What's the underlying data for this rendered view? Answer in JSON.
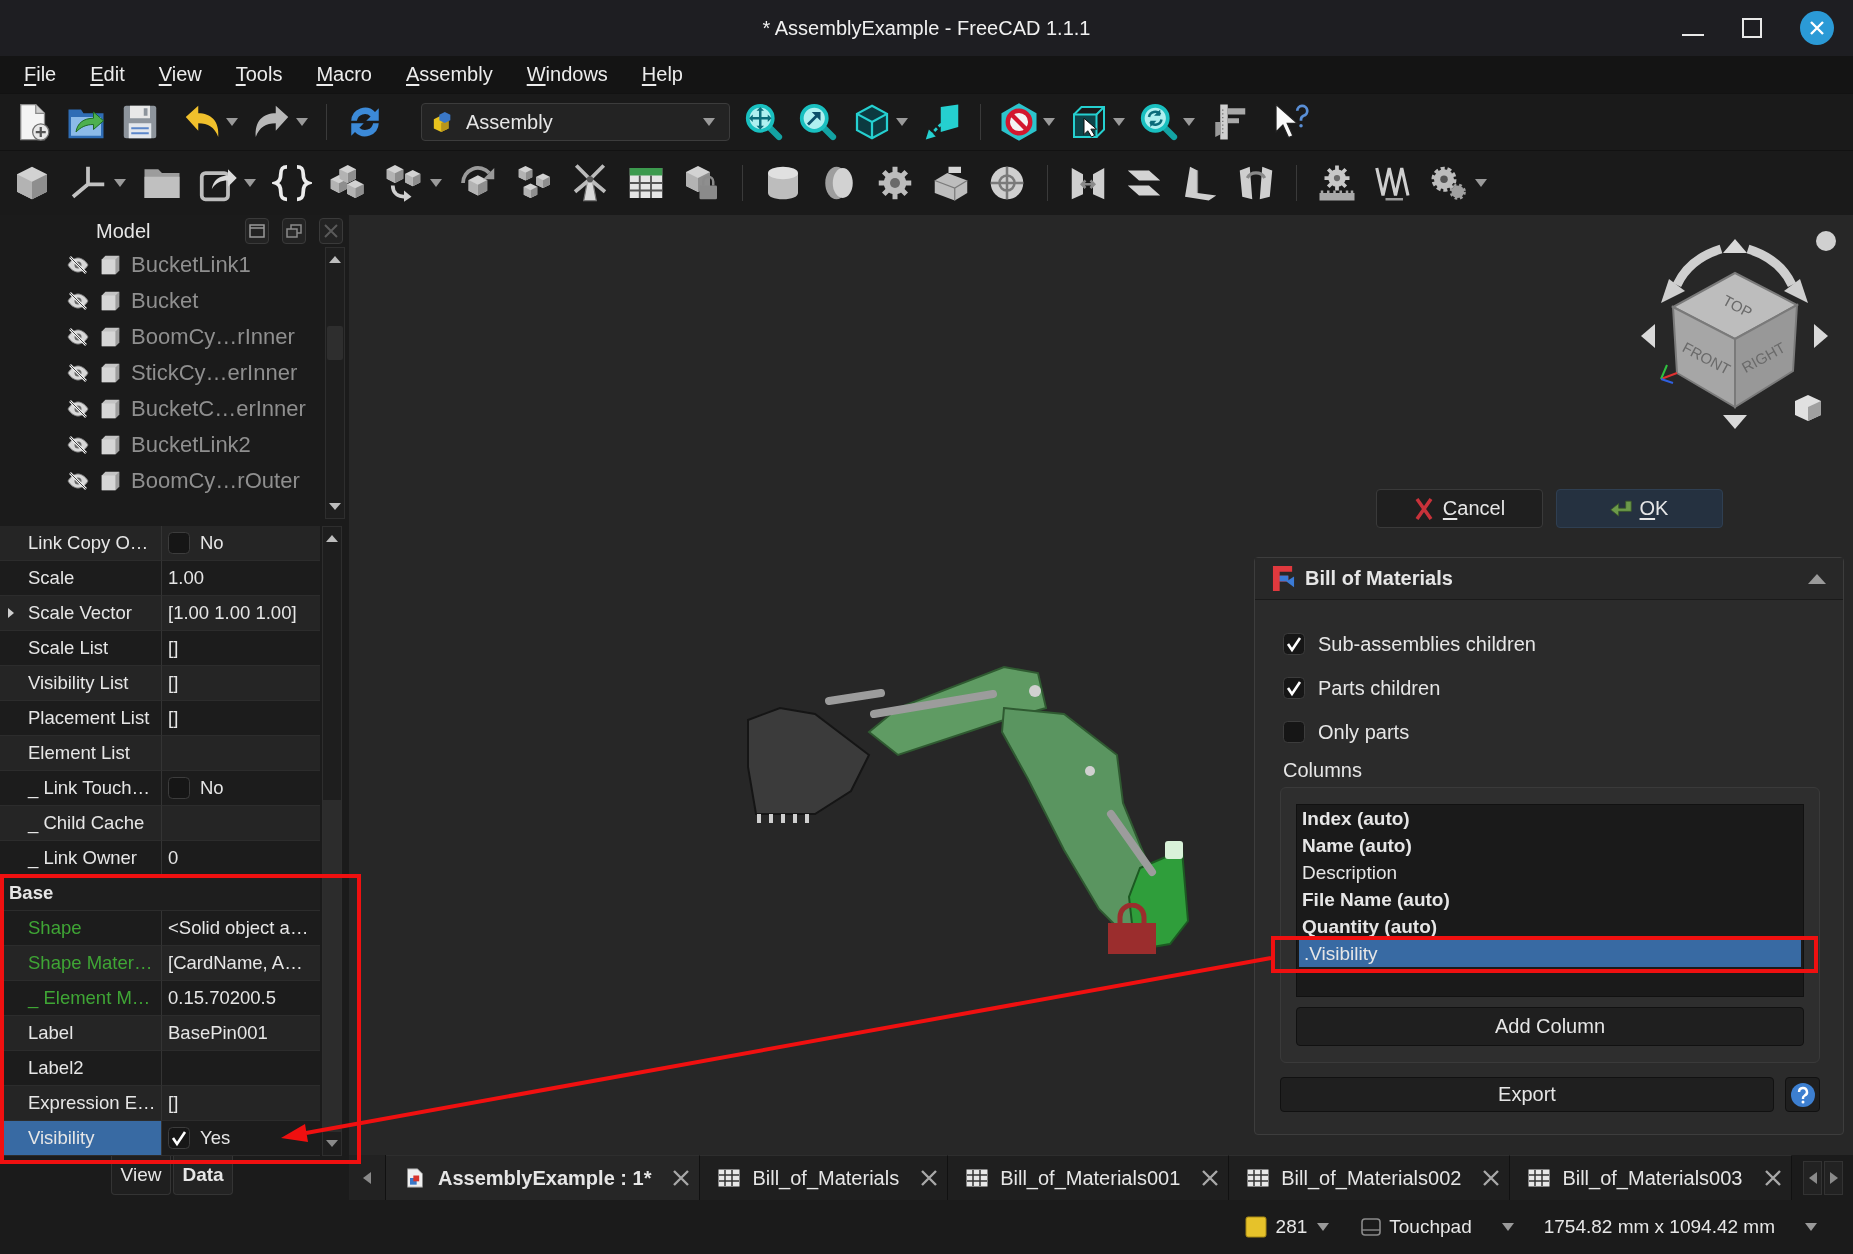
{
  "window": {
    "title": "* AssemblyExample - FreeCAD 1.1.1"
  },
  "menu_bar": [
    "File",
    "Edit",
    "View",
    "Tools",
    "Macro",
    "Assembly",
    "Windows",
    "Help"
  ],
  "toolbar": {
    "workbench": "Assembly"
  },
  "model_panel": {
    "title": "Model",
    "tree": [
      {
        "label": "BucketLink1",
        "visible": false
      },
      {
        "label": "Bucket",
        "visible": false
      },
      {
        "label": "BoomCy…rInner",
        "visible": false
      },
      {
        "label": "StickCy…erInner",
        "visible": false
      },
      {
        "label": "BucketC…erInner",
        "visible": false
      },
      {
        "label": "BucketLink2",
        "visible": false
      },
      {
        "label": "BoomCy…rOuter",
        "visible": false
      }
    ]
  },
  "property_view": {
    "rows": [
      {
        "kind": "checkbox",
        "name": "Link Copy O…",
        "value": "No",
        "checked": false,
        "color": "#e6e6e6",
        "selected": false
      },
      {
        "kind": "text",
        "name": "Scale",
        "value": "1.00",
        "color": "#e6e6e6",
        "selected": false
      },
      {
        "kind": "text",
        "name": "Scale Vector",
        "value": "[1.00 1.00 1.00]",
        "expanded": false,
        "color": "#e6e6e6",
        "selected": false
      },
      {
        "kind": "text",
        "name": "Scale List",
        "value": "[]",
        "color": "#e6e6e6",
        "selected": false
      },
      {
        "kind": "text",
        "name": "Visibility List",
        "value": "[]",
        "color": "#e6e6e6",
        "selected": false
      },
      {
        "kind": "text",
        "name": "Placement List",
        "value": "[]",
        "color": "#e6e6e6",
        "selected": false
      },
      {
        "kind": "text",
        "name": "Element List",
        "color": "#e6e6e6",
        "selected": false
      },
      {
        "kind": "checkbox",
        "name": "_ Link Touch…",
        "value": "No",
        "checked": false,
        "color": "#e6e6e6",
        "selected": false
      },
      {
        "kind": "text",
        "name": "_ Child Cache",
        "color": "#e6e6e6",
        "selected": false
      },
      {
        "kind": "text",
        "name": "_ Link Owner",
        "value": "0",
        "color": "#e6e6e6",
        "selected": false
      },
      {
        "kind": "group",
        "name": "Base"
      },
      {
        "kind": "text",
        "name": "Shape",
        "value": "<Solid object a…",
        "color": "#3fa535",
        "selected": false
      },
      {
        "kind": "text",
        "name": "Shape Mater…",
        "value": "[CardName, A…",
        "color": "#3fa535",
        "selected": false
      },
      {
        "kind": "text",
        "name": "_ Element M…",
        "value": "0.15.70200.5",
        "color": "#3fa535",
        "selected": false
      },
      {
        "kind": "text",
        "name": "Label",
        "value": "BasePin001",
        "color": "#e6e6e6",
        "selected": false
      },
      {
        "kind": "text",
        "name": "Label2",
        "color": "#e6e6e6",
        "selected": false
      },
      {
        "kind": "text",
        "name": "Expression E…",
        "value": "[]",
        "color": "#e6e6e6",
        "selected": false
      },
      {
        "kind": "checkbox",
        "name": "Visibility",
        "value": "Yes",
        "checked": true,
        "color": "#e6e6e6",
        "selected": true
      }
    ],
    "tabs": [
      {
        "label": "View",
        "selected": false
      },
      {
        "label": "Data",
        "selected": true
      }
    ]
  },
  "navigation_cube": {
    "faces": [
      "TOP",
      "FRONT",
      "RIGHT"
    ]
  },
  "task_buttons": [
    {
      "kind": "cancel",
      "label": "Cancel"
    },
    {
      "kind": "ok",
      "label": "OK"
    }
  ],
  "bom_panel": {
    "title": "Bill of Materials",
    "expanded": true,
    "options": [
      {
        "label": "Sub-assemblies children",
        "checked": true
      },
      {
        "label": "Parts children",
        "checked": true
      },
      {
        "label": "Only parts",
        "checked": false
      }
    ],
    "columns_label": "Columns",
    "columns": [
      {
        "label": "Index (auto)",
        "auto": true,
        "selected": false
      },
      {
        "label": "Name (auto)",
        "auto": true,
        "selected": false
      },
      {
        "label": "Description",
        "auto": false,
        "selected": false
      },
      {
        "label": "File Name (auto)",
        "auto": true,
        "selected": false
      },
      {
        "label": "Quantity (auto)",
        "auto": true,
        "selected": false
      },
      {
        "label": ".Visibility",
        "auto": false,
        "selected": true
      }
    ],
    "add_button": "Add Column",
    "export_button": "Export"
  },
  "document_tabs": [
    {
      "kind": "document",
      "label": "AssemblyExample : 1*",
      "selected": true
    },
    {
      "kind": "spreadsheet",
      "label": "Bill_of_Materials",
      "selected": false
    },
    {
      "kind": "spreadsheet",
      "label": "Bill_of_Materials001",
      "selected": false
    },
    {
      "kind": "spreadsheet",
      "label": "Bill_of_Materials002",
      "selected": false
    },
    {
      "kind": "spreadsheet",
      "label": "Bill_of_Materials003",
      "selected": false
    }
  ],
  "status_bar": {
    "selection_count": "281",
    "navigation_style": "Touchpad",
    "view_size": "1754.82 mm x 1094.42 mm"
  }
}
